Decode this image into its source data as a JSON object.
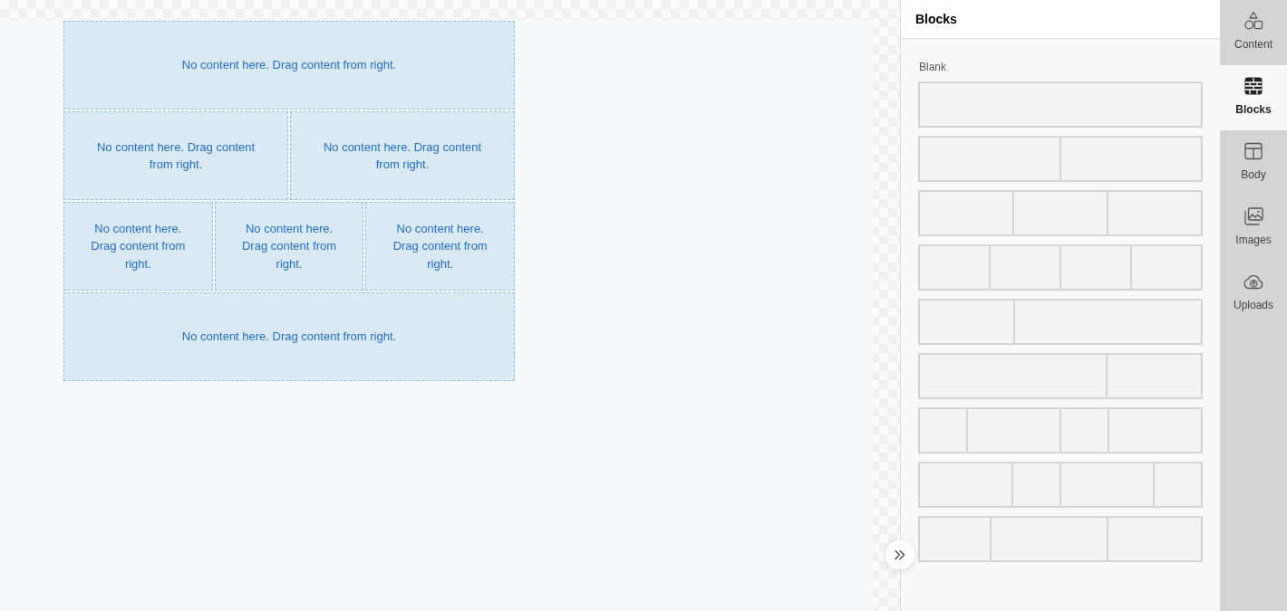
{
  "canvas": {
    "rows": [
      {
        "cells": [
          {
            "text": "No content here. Drag content from right."
          }
        ]
      },
      {
        "cells": [
          {
            "text": "No content here. Drag content from right."
          },
          {
            "text": "No content here. Drag content from right."
          }
        ]
      },
      {
        "cells": [
          {
            "text": "No content here. Drag content from right."
          },
          {
            "text": "No content here. Drag content from right."
          },
          {
            "text": "No content here. Drag content from right."
          }
        ]
      },
      {
        "cells": [
          {
            "text": "No content here. Drag content from right."
          }
        ]
      }
    ]
  },
  "panel": {
    "title": "Blocks",
    "section_label": "Blank",
    "layouts": [
      {
        "kind": "single"
      },
      {
        "kind": "halves"
      },
      {
        "kind": "thirds"
      },
      {
        "kind": "quarters"
      },
      {
        "kind": "narrow-wide"
      },
      {
        "kind": "wide-narrow"
      },
      {
        "kind": "narrow-wide-repeat"
      },
      {
        "kind": "wide-narrow-repeat"
      },
      {
        "kind": "narrow-wide-medium"
      }
    ]
  },
  "sidebar": {
    "tabs": [
      {
        "label": "Content",
        "selected": false
      },
      {
        "label": "Blocks",
        "selected": true
      },
      {
        "label": "Body",
        "selected": false
      },
      {
        "label": "Images",
        "selected": false
      },
      {
        "label": "Uploads",
        "selected": false
      }
    ]
  }
}
